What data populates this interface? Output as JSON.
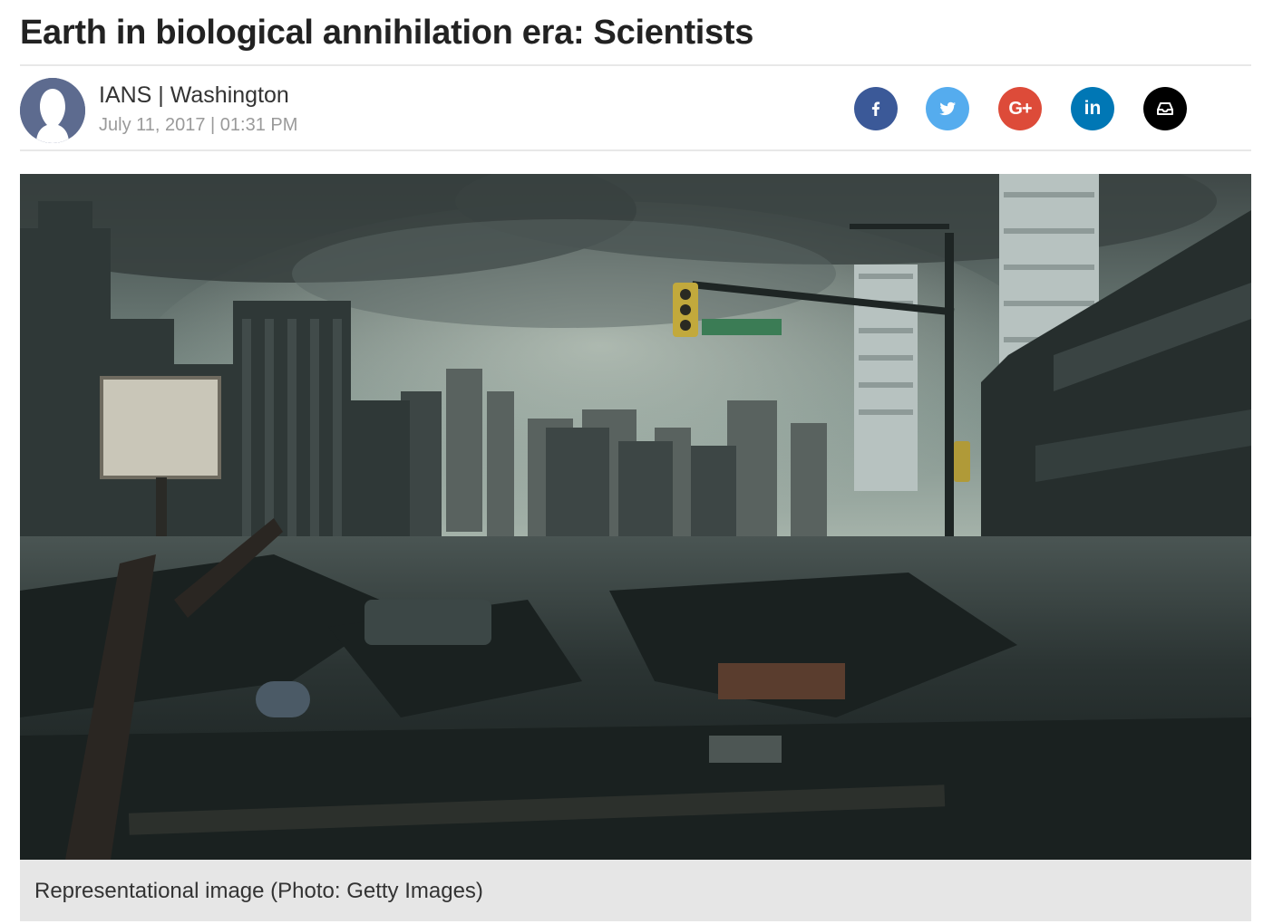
{
  "article": {
    "headline": "Earth in biological annihilation era: Scientists",
    "byline": "IANS | Washington",
    "dateline": "July 11, 2017 | 01:31 PM"
  },
  "author": {
    "avatar_icon": "person-silhouette-icon",
    "avatar_color": "#5d6b8f"
  },
  "share": {
    "buttons": [
      {
        "name": "facebook",
        "icon": "facebook-icon",
        "color": "#3b5998"
      },
      {
        "name": "twitter",
        "icon": "twitter-icon",
        "color": "#55acee"
      },
      {
        "name": "google-plus",
        "icon": "google-plus-icon",
        "color": "#dd4b39"
      },
      {
        "name": "linkedin",
        "icon": "linkedin-icon",
        "color": "#0077b5"
      },
      {
        "name": "inbox",
        "icon": "inbox-icon",
        "color": "#000000"
      }
    ],
    "google_plus_label": "G+",
    "linkedin_label": "in"
  },
  "figure": {
    "image_description_icon": "ruined-city-photo",
    "caption": "Representational image (Photo: Getty Images)"
  }
}
